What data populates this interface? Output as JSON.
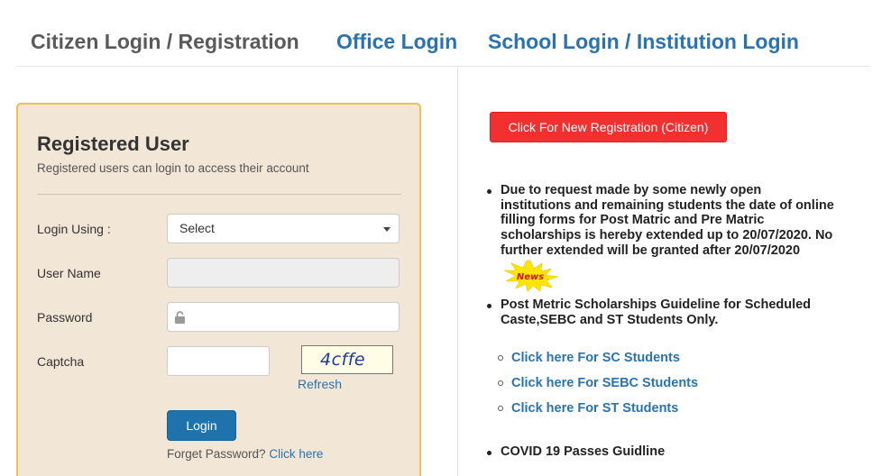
{
  "tabs": {
    "citizen": "Citizen Login / Registration",
    "office": "Office Login",
    "school": "School Login / Institution Login"
  },
  "login_panel": {
    "title": "Registered User",
    "subtitle": "Registered users can login to access their account",
    "login_using_label": "Login Using :",
    "login_using_value": "Select",
    "username_label": "User Name",
    "password_label": "Password",
    "captcha_label": "Captcha",
    "captcha_text": "4cffe",
    "refresh_label": "Refresh",
    "login_button": "Login",
    "forgot_text": "Forget Password?",
    "forgot_link": "Click here"
  },
  "right": {
    "register_button": "Click For New Registration (Citizen)",
    "notice_1_lines": [
      "Due to request made by some newly open",
      "institutions and remaining students the date of online",
      "filling forms for Post Matric and Pre Matric",
      "scholarships is hereby extended up to 20/07/2020. No",
      "further extended will be granted after 20/07/2020"
    ],
    "news_badge": "News",
    "notice_2_lines": [
      "Post Metric Scholarships Guideline for Scheduled",
      "Caste,SEBC and ST Students Only."
    ],
    "sub_links": [
      "Click here For SC Students",
      "Click here For SEBC Students",
      "Click here For ST Students"
    ],
    "notice_3": "COVID 19 Passes Guidline"
  },
  "colors": {
    "panel_bg": "#f2e6d6",
    "panel_border": "#f0c050",
    "link": "#2a73b0",
    "login_button": "#1e73ad",
    "register_button": "#f23030"
  }
}
